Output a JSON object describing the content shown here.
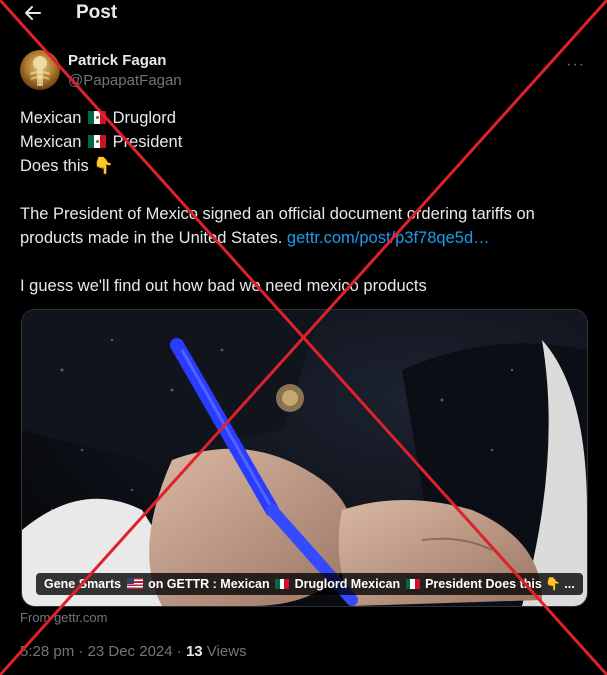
{
  "header": {
    "back_icon": "arrow-left-icon",
    "title": "Post"
  },
  "author": {
    "name": "Patrick Fagan",
    "handle": "@PapapatFagan"
  },
  "more_icon": "more-horizontal-icon",
  "more_label": "···",
  "tweet": {
    "line1_a": "Mexican ",
    "line1_b": " Druglord",
    "line2_a": "Mexican ",
    "line2_b": " President",
    "line3": "Does this 👇",
    "para1": "The President of Mexico signed an official document ordering tariffs on products made in the United States. ",
    "link": "gettr.com/post/p3f78qe5d…",
    "para2": "I guess we'll find out how bad we need mexico products"
  },
  "media": {
    "caption_a": "Gene Smarts ",
    "caption_b": " on GETTR : Mexican ",
    "caption_c": " Druglord Mexican ",
    "caption_d": " President Does this 👇 ..."
  },
  "source": "From gettr.com",
  "meta": {
    "time": "5:28 pm · 23 Dec 2024 · ",
    "views_count": "13",
    "views_label": " Views"
  },
  "overlay": {
    "mark": "red-x-icon",
    "color": "#e0202a"
  },
  "colors": {
    "background": "#000000",
    "text": "#e7e9ea",
    "muted": "#71767b",
    "link": "#1d9bf0"
  }
}
